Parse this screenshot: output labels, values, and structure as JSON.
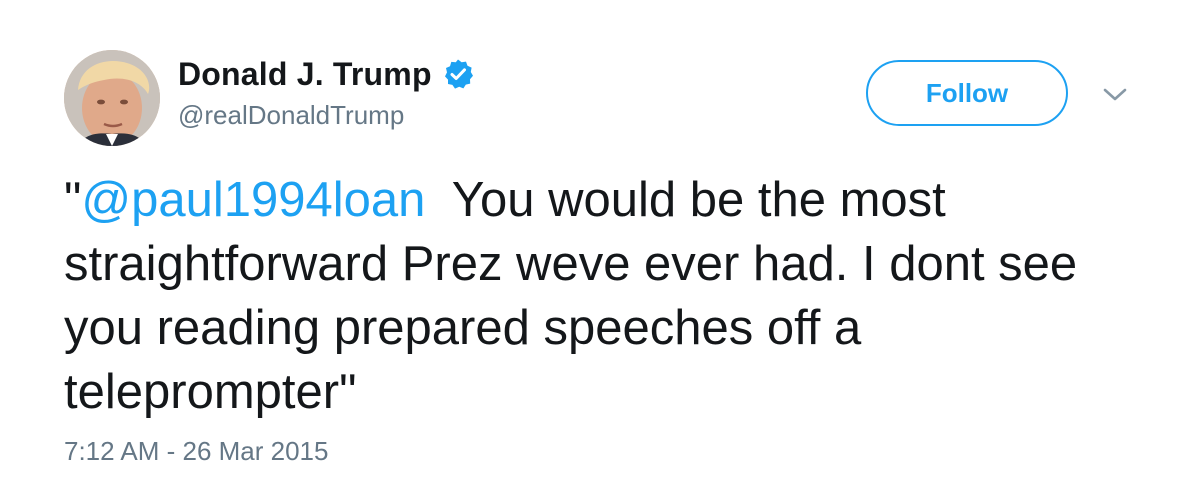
{
  "author": {
    "display_name": "Donald J. Trump",
    "handle": "@realDonaldTrump",
    "verified": true,
    "avatar_icon": "profile-photo"
  },
  "actions": {
    "follow_label": "Follow",
    "more_icon": "chevron-down-icon"
  },
  "tweet": {
    "open_quote": "\"",
    "mention": "@paul1994loan",
    "text_after_mention": "  You would be the most straightforward Prez weve ever had. I dont see you reading prepared speeches off a teleprompter\"",
    "timestamp": "7:12 AM - 26 Mar 2015"
  },
  "colors": {
    "accent": "#1da1f2",
    "text": "#14171a",
    "secondary_text": "#657786"
  }
}
